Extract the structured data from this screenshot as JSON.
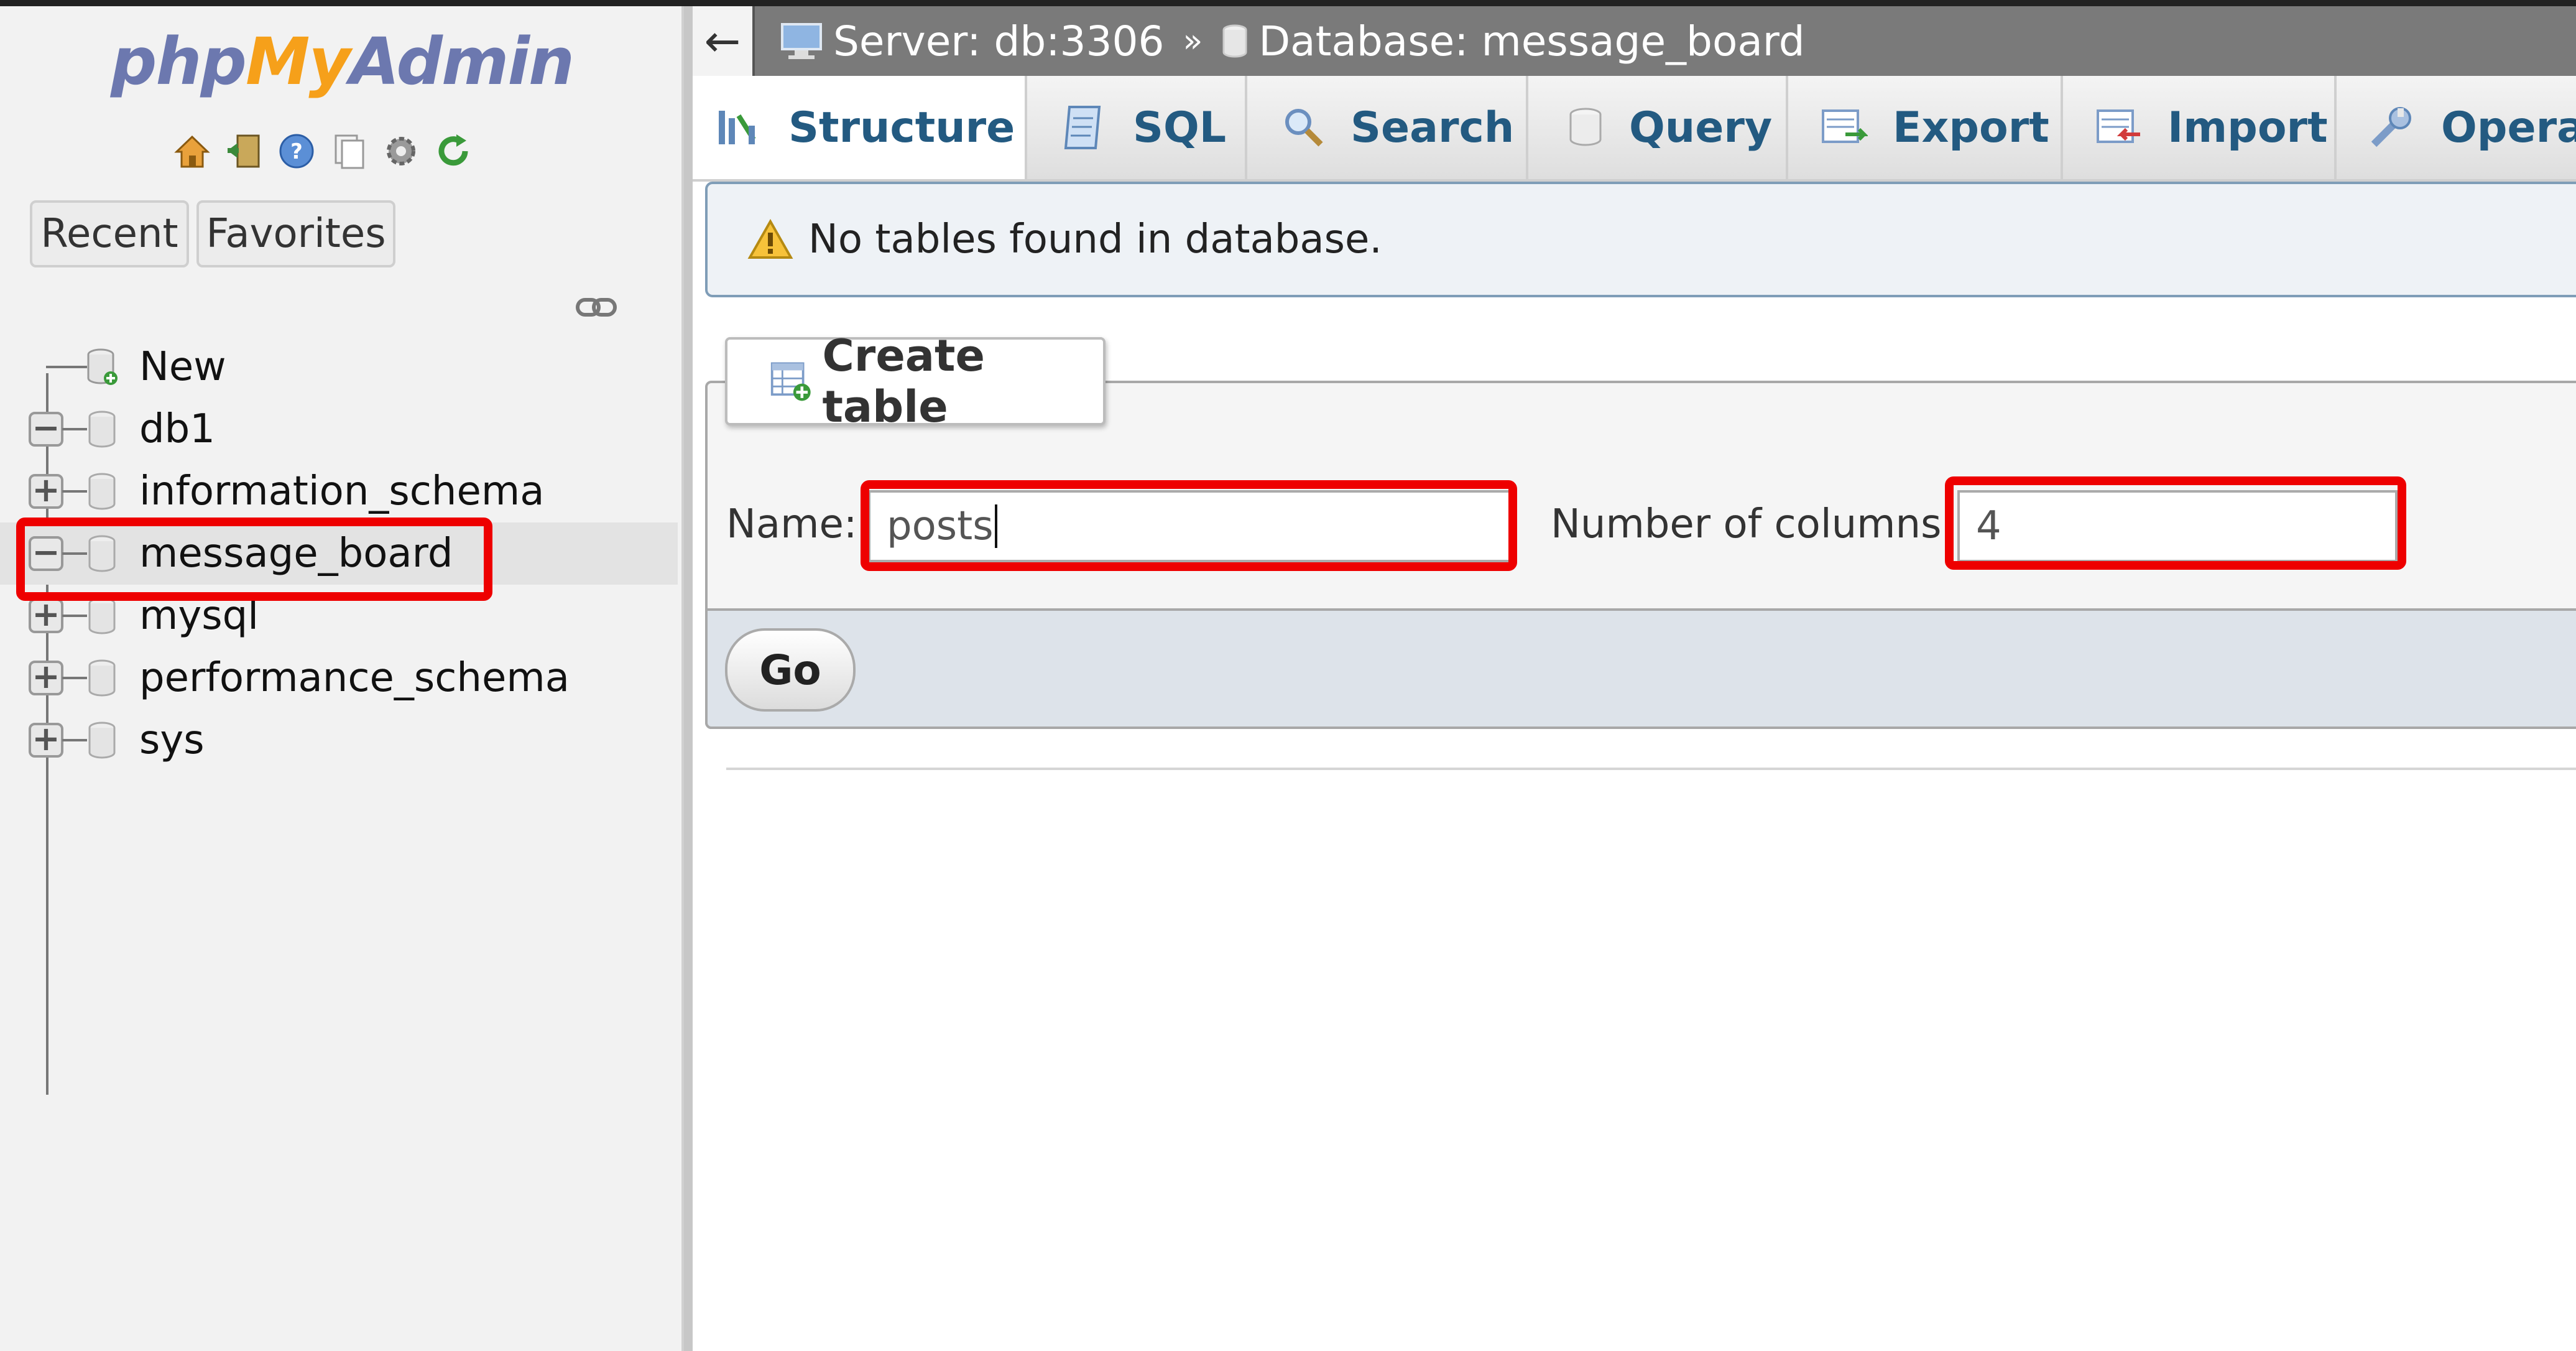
{
  "colors": {
    "highlight": "#ee0000",
    "tab_text": "#235a81",
    "breadcrumb_bg": "#7a7a7a"
  },
  "navigation": {
    "logo": {
      "part1": "php",
      "part2": "My",
      "part3": "Admin"
    },
    "quick_icons": [
      "home-icon",
      "logout-icon",
      "help-icon",
      "docs-icon",
      "settings-icon",
      "reload-icon"
    ],
    "recent_label": "Recent",
    "favorites_label": "Favorites",
    "tree": [
      {
        "label": "New",
        "expander": ""
      },
      {
        "label": "db1",
        "expander": "−"
      },
      {
        "label": "information_schema",
        "expander": "+"
      },
      {
        "label": "message_board",
        "expander": "−"
      },
      {
        "label": "mysql",
        "expander": "+"
      },
      {
        "label": "performance_schema",
        "expander": "+"
      },
      {
        "label": "sys",
        "expander": "+"
      }
    ]
  },
  "breadcrumb": {
    "back": "←",
    "server": "Server: db:3306",
    "separator": "»",
    "database": "Database: message_board"
  },
  "tabs": [
    "Structure",
    "SQL",
    "Search",
    "Query",
    "Export",
    "Import",
    "Opera"
  ],
  "notice": "No tables found in database.",
  "create_table": {
    "legend": "Create table",
    "name_label": "Name:",
    "name_value": "posts",
    "columns_label": "Number of columns:",
    "columns_value": "4",
    "go_label": "Go"
  }
}
